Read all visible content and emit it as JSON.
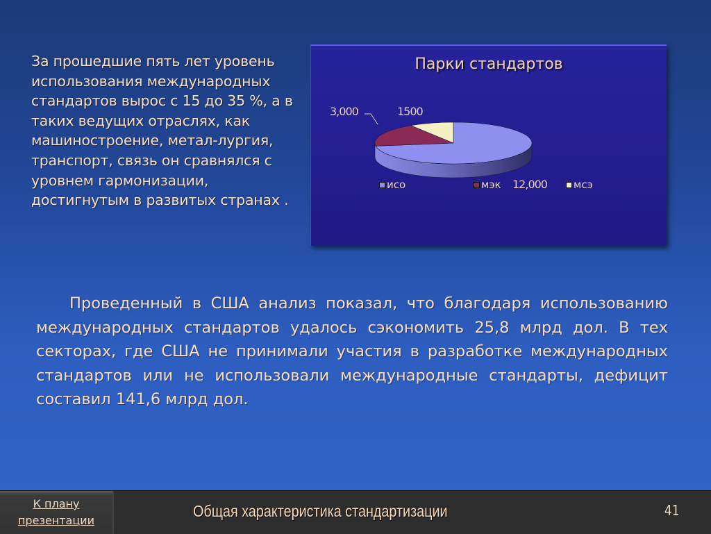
{
  "slide": {
    "intro_text": "За прошедшие пять лет уровень использования международных стандартов вырос с 15 до 35 %, а в таких ведущих отраслях, как машиностроение, метал-лургия, транспорт, связь он сравнялся с уровнем гармонизации, достигнутым в развитых странах .",
    "body_text": "Проведенный в США анализ показал, что благодаря использованию международных стандартов удалось сэкономить 25,8 млрд дол. В тех секторах, где США не принимали участия в разработке международных стандартов или не использовали международные стандарты, дефицит составил 141,6 млрд дол."
  },
  "chart_data": {
    "type": "pie",
    "title": "Парки стандартов",
    "categories": [
      "исо",
      "мэк",
      "мсэ"
    ],
    "values": [
      12000,
      3000,
      1500
    ],
    "data_labels": [
      "12,000",
      "3,000",
      "1500"
    ],
    "colors": [
      "#8f8ff0",
      "#8b2a55",
      "#f4f0c4"
    ],
    "legend_position": "bottom",
    "three_d": true
  },
  "footer": {
    "plan_button_line1": "К плану",
    "plan_button_line2": "презентации",
    "title": "Общая характеристика  стандартизации",
    "page_number": "41"
  }
}
